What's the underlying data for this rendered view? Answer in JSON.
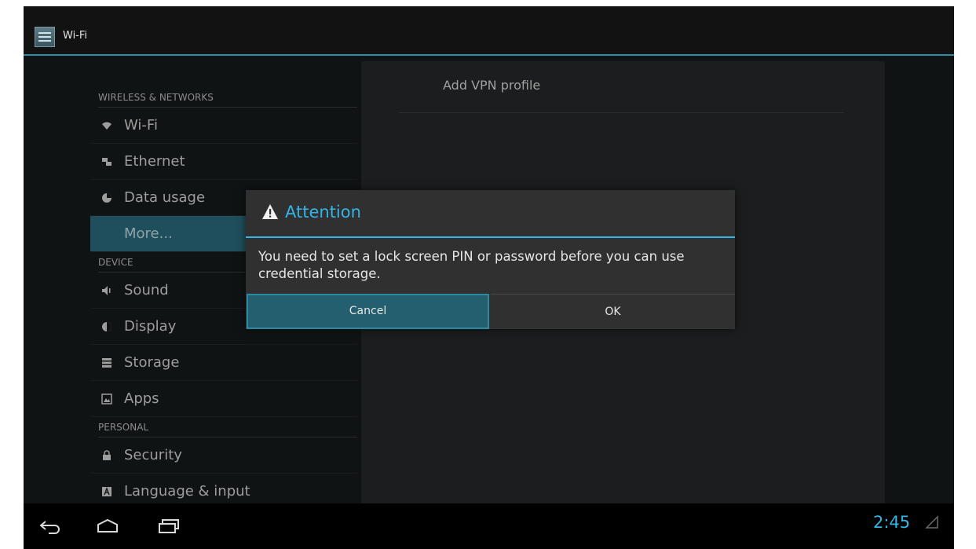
{
  "action_bar": {
    "title": "Wi-Fi",
    "app_icon": "settings-app-icon"
  },
  "sidebar": {
    "sections": [
      {
        "label": "WIRELESS & NETWORKS"
      },
      {
        "label": "DEVICE"
      },
      {
        "label": "PERSONAL"
      }
    ],
    "items": [
      {
        "label": "Wi-Fi",
        "icon": "wifi-icon"
      },
      {
        "label": "Ethernet",
        "icon": "ethernet-icon"
      },
      {
        "label": "Data usage",
        "icon": "data-usage-icon"
      },
      {
        "label": "More...",
        "icon": ""
      },
      {
        "label": "Sound",
        "icon": "sound-icon"
      },
      {
        "label": "Display",
        "icon": "display-icon"
      },
      {
        "label": "Storage",
        "icon": "storage-icon"
      },
      {
        "label": "Apps",
        "icon": "apps-icon"
      },
      {
        "label": "Security",
        "icon": "lock-icon"
      },
      {
        "label": "Language & input",
        "icon": "keyboard-icon"
      }
    ]
  },
  "right_pane": {
    "title": "Add VPN profile"
  },
  "dialog": {
    "title": "Attention",
    "message": "You need to set a lock screen PIN or password before you can use credential storage.",
    "cancel_label": "Cancel",
    "ok_label": "OK"
  },
  "system_bar": {
    "time": "2:45"
  },
  "colors": {
    "accent": "#33b5e5",
    "selected_bg": "#1f4f5c",
    "dialog_bg": "#303030"
  }
}
